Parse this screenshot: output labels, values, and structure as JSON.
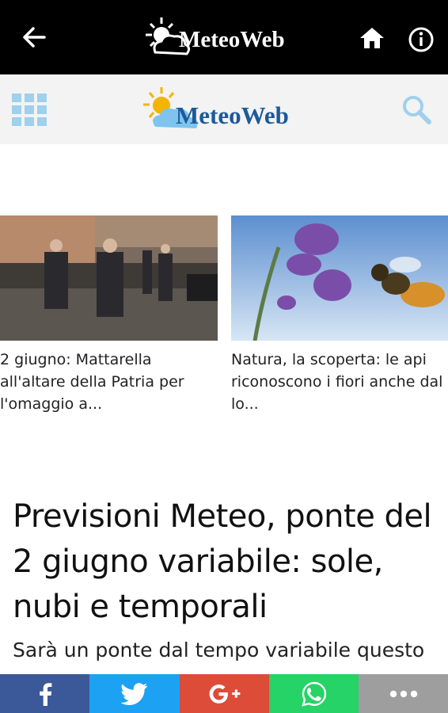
{
  "appbar": {
    "logo_text": "MeteoWeb",
    "icons": [
      "back-arrow-icon",
      "home-icon",
      "info-icon"
    ]
  },
  "site_header": {
    "logo_text": "MeteoWeb",
    "icons": [
      "grid-menu-icon",
      "search-icon"
    ],
    "accent_color": "#1d5a99",
    "icon_color": "#9fd0ec"
  },
  "cards": [
    {
      "caption": "2 giugno: Mattarella all'altare della Patria per l'omaggio a..."
    },
    {
      "caption": "Natura, la scoperta: le api riconoscono i fiori anche dal lo..."
    }
  ],
  "article": {
    "headline": "Previsioni Meteo, ponte del 2 giugno variabile: sole, nubi e temporali",
    "lead": "Sarà un ponte dal tempo variabile questo"
  },
  "share_bar": [
    {
      "network": "facebook",
      "icon": "facebook-icon",
      "color": "#3b5998"
    },
    {
      "network": "twitter",
      "icon": "twitter-icon",
      "color": "#1da1f2"
    },
    {
      "network": "google-plus",
      "icon": "google-plus-icon",
      "color": "#dd4b39"
    },
    {
      "network": "whatsapp",
      "icon": "whatsapp-icon",
      "color": "#25d366"
    },
    {
      "network": "more",
      "icon": "more-icon",
      "color": "#9e9e9e"
    }
  ]
}
